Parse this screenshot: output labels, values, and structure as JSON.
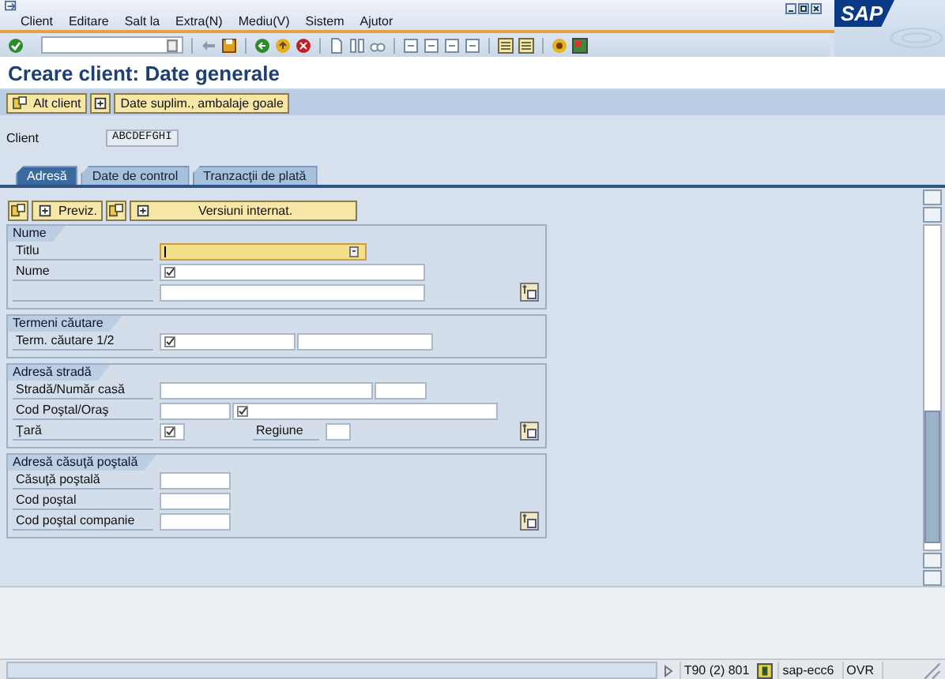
{
  "menu": [
    {
      "label": "Client"
    },
    {
      "label": "Editare"
    },
    {
      "label": "Salt la"
    },
    {
      "label": "Extra(N)"
    },
    {
      "label": "Mediu(V)"
    },
    {
      "label": "Sistem"
    },
    {
      "label": "Ajutor"
    }
  ],
  "logo": "SAP",
  "title": "Creare client: Date generale",
  "app_toolbar": [
    {
      "kind": "text_icon",
      "label": "Alt client"
    },
    {
      "kind": "icon"
    },
    {
      "kind": "text",
      "label": "Date suplim., ambalaje goale"
    }
  ],
  "client": {
    "label": "Client",
    "value": "ABCDEFGHI"
  },
  "tabs": [
    {
      "label": "Adresă",
      "selected": true
    },
    {
      "label": "Date de control",
      "selected": false
    },
    {
      "label": "Tranzacţii de plată",
      "selected": false
    }
  ],
  "inner_toolbar": [
    {
      "kind": "icon"
    },
    {
      "kind": "text_icon",
      "label": "Previz."
    },
    {
      "kind": "icon"
    },
    {
      "kind": "text_icon",
      "label": "Versiuni internat."
    }
  ],
  "groups": [
    {
      "title": "Nume",
      "more": true,
      "rows": [
        {
          "label": "Titlu",
          "fields": [
            {
              "kind": "dropdown",
              "required": false,
              "focused": true
            }
          ]
        },
        {
          "label": "Nume",
          "fields": [
            {
              "kind": "long",
              "required": true,
              "focused": false
            }
          ]
        },
        {
          "fields": [
            {
              "kind": "long",
              "required": false,
              "focused": false
            }
          ]
        }
      ]
    },
    {
      "title": "Termeni căutare",
      "more": false,
      "rows": [
        {
          "label": "Term. căutare 1/2",
          "fields": [
            {
              "kind": "half",
              "required": true,
              "focused": false
            },
            {
              "kind": "half",
              "required": false,
              "focused": false
            }
          ]
        }
      ]
    },
    {
      "title": "Adresă stradă",
      "more": true,
      "rows": [
        {
          "label": "Stradă/Număr casă",
          "fields": [
            {
              "kind": "medium",
              "required": false,
              "focused": false
            },
            {
              "kind": "small",
              "required": false,
              "focused": false
            }
          ]
        },
        {
          "label": "Cod Poştal/Oraş",
          "fields": [
            {
              "kind": "short",
              "required": false,
              "focused": false
            },
            {
              "kind": "long",
              "required": true,
              "focused": false
            }
          ]
        },
        {
          "label": "Ţară",
          "fields": [
            {
              "kind": "tiny",
              "required": true,
              "focused": false
            }
          ],
          "extra_label": "Regiune",
          "extra_fields": [
            {
              "kind": "tiny",
              "required": false,
              "focused": false
            }
          ]
        }
      ]
    },
    {
      "title": "Adresă căsuţă poştală",
      "more": true,
      "rows": [
        {
          "label": "Căsuţă poştală",
          "fields": [
            {
              "kind": "short",
              "required": false,
              "focused": false
            }
          ]
        },
        {
          "label": "Cod poştal",
          "fields": [
            {
              "kind": "short",
              "required": false,
              "focused": false
            }
          ]
        },
        {
          "label": "Cod poştal companie",
          "fields": [
            {
              "kind": "short",
              "required": false,
              "focused": false
            }
          ]
        }
      ]
    }
  ],
  "status_bar": {
    "session": "T90 (2) 801",
    "server": "sap-ecc6",
    "mode": "OVR"
  }
}
